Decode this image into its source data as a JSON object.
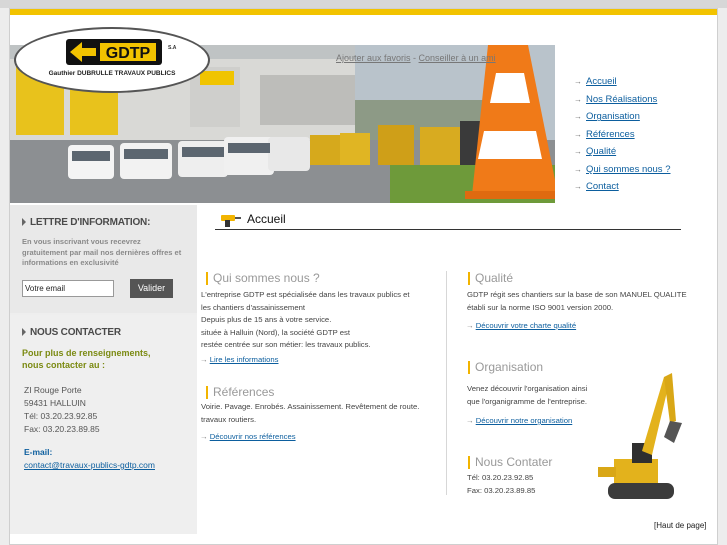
{
  "header": {
    "logo": {
      "brand": "GDTP",
      "sa": "S.A",
      "company": "Gauthier DUBRULLE TRAVAUX PUBLICS"
    },
    "toplinks": {
      "favoris": "Ajouter aux favoris",
      "sep": " - ",
      "conseiller": "Conseiller à un ami"
    },
    "nav": [
      "Accueil",
      "Nos Réalisations",
      "Organisation",
      "Références",
      "Qualité",
      "Qui sommes nous ?",
      "Contact"
    ]
  },
  "sidebar": {
    "newsletter": {
      "title": "LETTRE D'INFORMATION:",
      "intro": "En vous inscrivant vous recevrez gratuitement par mail nos dernières offres et informations en exclusivité",
      "email_value": "Votre email",
      "button": "Valider"
    },
    "contact": {
      "title": "NOUS CONTACTER",
      "lead1": "Pour plus de renseignements,",
      "lead2": "nous contacter au :",
      "address": [
        "ZI Rouge Porte",
        "59431 HALLUIN",
        "Tél: 03.20.23.92.85",
        "Fax: 03.20.23.89.85"
      ],
      "email_label": "E-mail:",
      "email": "contact@travaux-publics-gdtp.com"
    }
  },
  "main": {
    "title": "Accueil",
    "qui": {
      "heading": "Qui sommes nous ?",
      "lines": [
        "L'entreprise GDTP est spécialisée dans les travaux publics et",
        "les chantiers d'assainissement",
        "Depuis plus de 15 ans à votre service.",
        "située à Halluin (Nord), la société GDTP est",
        "restée centrée sur son métier: les travaux publics."
      ],
      "link": "Lire les informations"
    },
    "references": {
      "heading": "Références",
      "lines": [
        "Voirie. Pavage. Enrobés. Assainissement. Revêtement de route.",
        "travaux routiers."
      ],
      "link": "Découvrir nos références"
    },
    "qualite": {
      "heading": "Qualité",
      "lines": [
        "GDTP régit ses chantiers sur la base de son MANUEL QUALITE",
        "établi sur la norme ISO 9001 version 2000."
      ],
      "link": "Découvrir votre charte qualité"
    },
    "organisation": {
      "heading": "Organisation",
      "lines": [
        "Venez découvrir l'organisation ainsi",
        "que l'organigramme de l'entreprise."
      ],
      "link": "Découvrir notre organisation"
    },
    "contacter": {
      "heading": "Nous Contater",
      "lines": [
        "Tél: 03.20.23.92.85",
        "Fax: 03.20.23.89.85"
      ]
    },
    "haut": "[Haut de page]"
  },
  "colors": {
    "gold": "#f2c300",
    "link": "#0c5e9e",
    "green": "#7b8a12",
    "accent_bar": "#f2b400"
  }
}
